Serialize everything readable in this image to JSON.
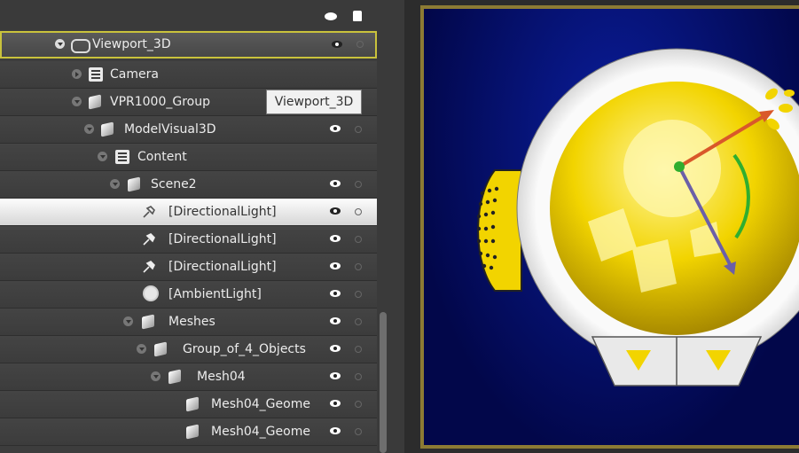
{
  "tree": {
    "root_label": "Viewport_3D",
    "items": [
      {
        "label": "Camera"
      },
      {
        "label": "VPR1000_Group"
      },
      {
        "label": "ModelVisual3D"
      },
      {
        "label": "Content"
      },
      {
        "label": "Scene2"
      },
      {
        "label": "[DirectionalLight]"
      },
      {
        "label": "[DirectionalLight]"
      },
      {
        "label": "[DirectionalLight]"
      },
      {
        "label": "[AmbientLight]"
      },
      {
        "label": "Meshes"
      },
      {
        "label": "Group_of_4_Objects"
      },
      {
        "label": "Mesh04"
      },
      {
        "label": "Mesh04_Geome"
      },
      {
        "label": "Mesh04_Geome"
      }
    ],
    "tooltip": "Viewport_3D"
  },
  "colors": {
    "accent_border": "#c9c23c",
    "viewport_bg": "#0a1d9c",
    "viewport_frame": "#8c7b34",
    "model_yellow": "#f2d400",
    "gizmo_x": "#d9582a",
    "gizmo_y": "#2fae2f",
    "gizmo_z": "#6b5fa8"
  },
  "icons": {
    "header": [
      "eye-icon",
      "lock-icon"
    ],
    "row": [
      "expander-icon",
      "eye-icon",
      "lock-icon"
    ],
    "types": [
      "group-icon",
      "camera-icon",
      "content-icon",
      "cube-icon",
      "directional-light-icon",
      "ambient-light-icon"
    ]
  }
}
